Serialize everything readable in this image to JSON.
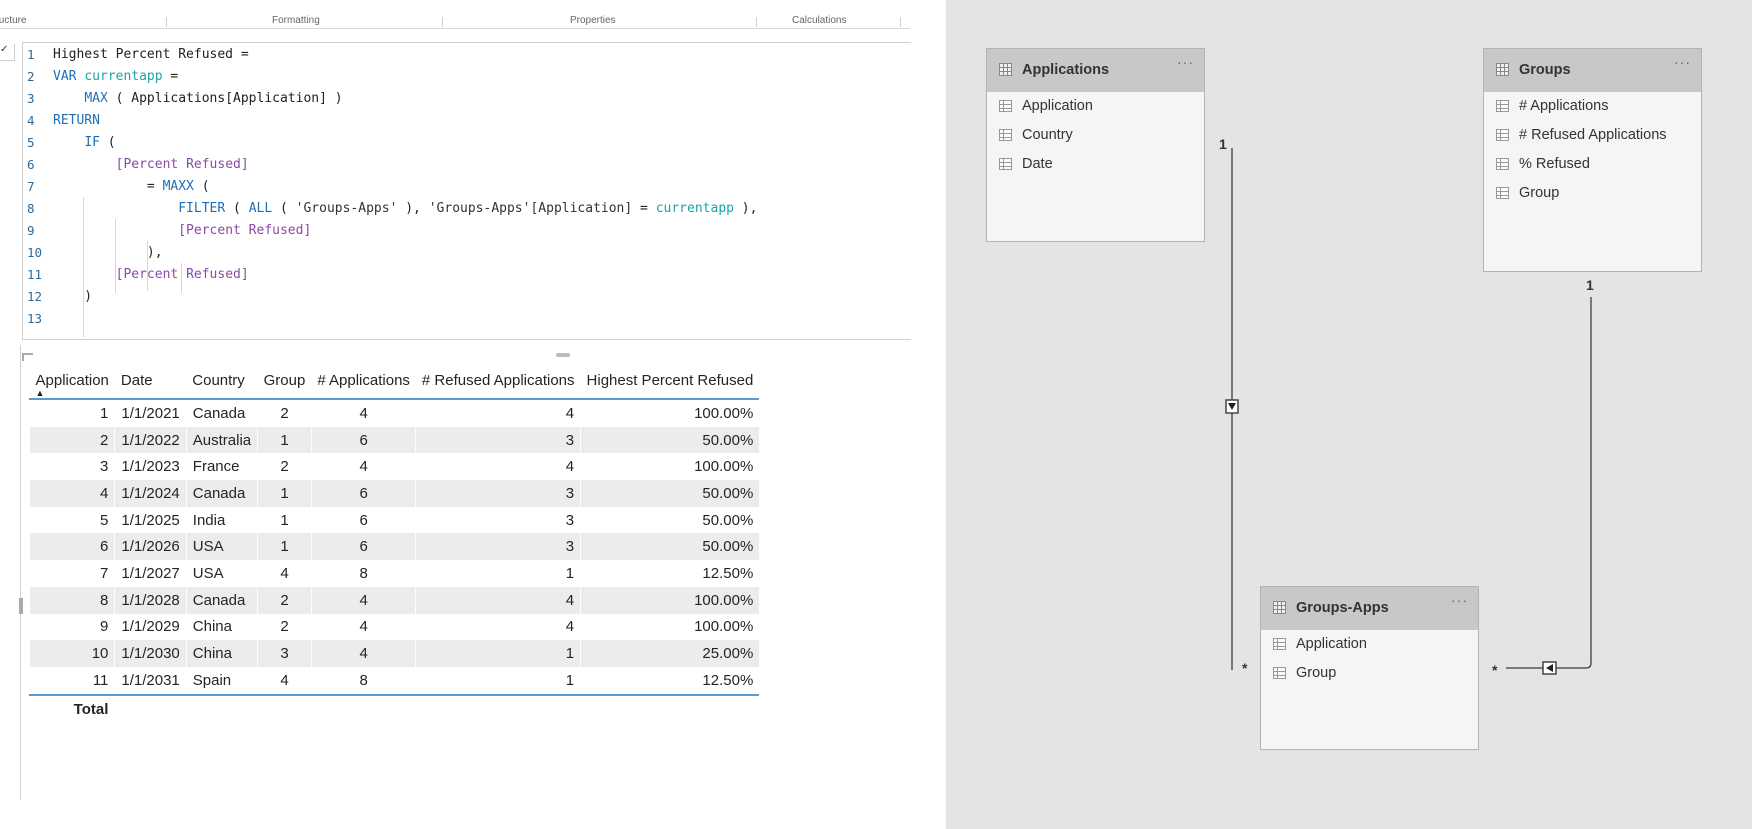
{
  "ribbon": {
    "tabs": [
      "Structure",
      "Formatting",
      "Properties",
      "Calculations"
    ]
  },
  "editor": {
    "line_numbers": [
      "1",
      "2",
      "3",
      "4",
      "5",
      "6",
      "7",
      "8",
      "9",
      "10",
      "11",
      "12",
      "13"
    ],
    "measure_name": "Highest Percent Refused",
    "var_keyword": "VAR",
    "var_name": "currentapp",
    "max_fn": "MAX",
    "max_arg": "Applications[Application]",
    "return_keyword": "RETURN",
    "if_fn": "IF",
    "measure_ref": "[Percent Refused]",
    "maxx_fn": "MAXX",
    "filter_fn": "FILTER",
    "all_fn": "ALL",
    "table_str": "'Groups-Apps'",
    "col_str": "'Groups-Apps'[Application]"
  },
  "table": {
    "headers": [
      "Application",
      "Date",
      "Country",
      "Group",
      "# Applications",
      "# Refused Applications",
      "Highest Percent Refused"
    ],
    "sort_indicator": "▲",
    "rows": [
      [
        "1",
        "1/1/2021",
        "Canada",
        "2",
        "4",
        "4",
        "100.00%"
      ],
      [
        "2",
        "1/1/2022",
        "Australia",
        "1",
        "6",
        "3",
        "50.00%"
      ],
      [
        "3",
        "1/1/2023",
        "France",
        "2",
        "4",
        "4",
        "100.00%"
      ],
      [
        "4",
        "1/1/2024",
        "Canada",
        "1",
        "6",
        "3",
        "50.00%"
      ],
      [
        "5",
        "1/1/2025",
        "India",
        "1",
        "6",
        "3",
        "50.00%"
      ],
      [
        "6",
        "1/1/2026",
        "USA",
        "1",
        "6",
        "3",
        "50.00%"
      ],
      [
        "7",
        "1/1/2027",
        "USA",
        "4",
        "8",
        "1",
        "12.50%"
      ],
      [
        "8",
        "1/1/2028",
        "Canada",
        "2",
        "4",
        "4",
        "100.00%"
      ],
      [
        "9",
        "1/1/2029",
        "China",
        "2",
        "4",
        "4",
        "100.00%"
      ],
      [
        "10",
        "1/1/2030",
        "China",
        "3",
        "4",
        "1",
        "25.00%"
      ],
      [
        "11",
        "1/1/2031",
        "Spain",
        "4",
        "8",
        "1",
        "12.50%"
      ]
    ],
    "total_label": "Total"
  },
  "model": {
    "tables": [
      {
        "name": "Applications",
        "fields": [
          "Application",
          "Country",
          "Date"
        ]
      },
      {
        "name": "Groups",
        "fields": [
          "# Applications",
          "# Refused Applications",
          "% Refused",
          "Group"
        ]
      },
      {
        "name": "Groups-Apps",
        "fields": [
          "Application",
          "Group"
        ]
      }
    ],
    "more_glyph": "···",
    "cardinality_one": "1",
    "cardinality_many": "*"
  },
  "colors": {
    "accent": "#5b9bd5",
    "keyword": "#1f6fb7",
    "variable": "#1aa4a8",
    "measure": "#8a4aa6",
    "canvas": "#e5e4e2"
  }
}
